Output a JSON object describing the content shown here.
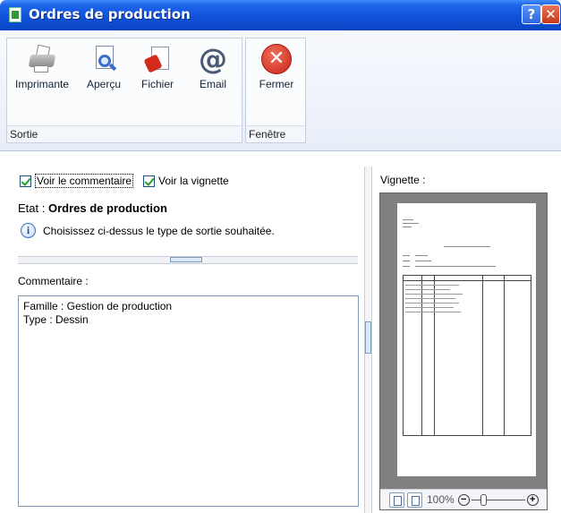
{
  "window": {
    "title": "Ordres de production",
    "help_label": "?",
    "close_label": "✕"
  },
  "ribbon": {
    "groups": [
      {
        "caption": "Sortie",
        "buttons": [
          {
            "label": "Imprimante",
            "icon": "printer-icon"
          },
          {
            "label": "Aperçu",
            "icon": "preview-icon"
          },
          {
            "label": "Fichier",
            "icon": "file-export-icon"
          },
          {
            "label": "Email",
            "icon": "email-icon"
          }
        ]
      },
      {
        "caption": "Fenêtre",
        "buttons": [
          {
            "label": "Fermer",
            "icon": "close-icon"
          }
        ]
      }
    ]
  },
  "options": {
    "show_comment_label": "Voir le commentaire",
    "show_comment_checked": true,
    "show_thumbnail_label": "Voir la vignette",
    "show_thumbnail_checked": true
  },
  "etat": {
    "label": "Etat :",
    "value": "Ordres de production",
    "hint": "Choisissez ci-dessus le type de sortie souhaitée."
  },
  "comment": {
    "label": "Commentaire :",
    "lines": [
      "Famille : Gestion de production",
      "Type : Dessin"
    ]
  },
  "thumbnail": {
    "label": "Vignette :",
    "zoom": "100%"
  }
}
